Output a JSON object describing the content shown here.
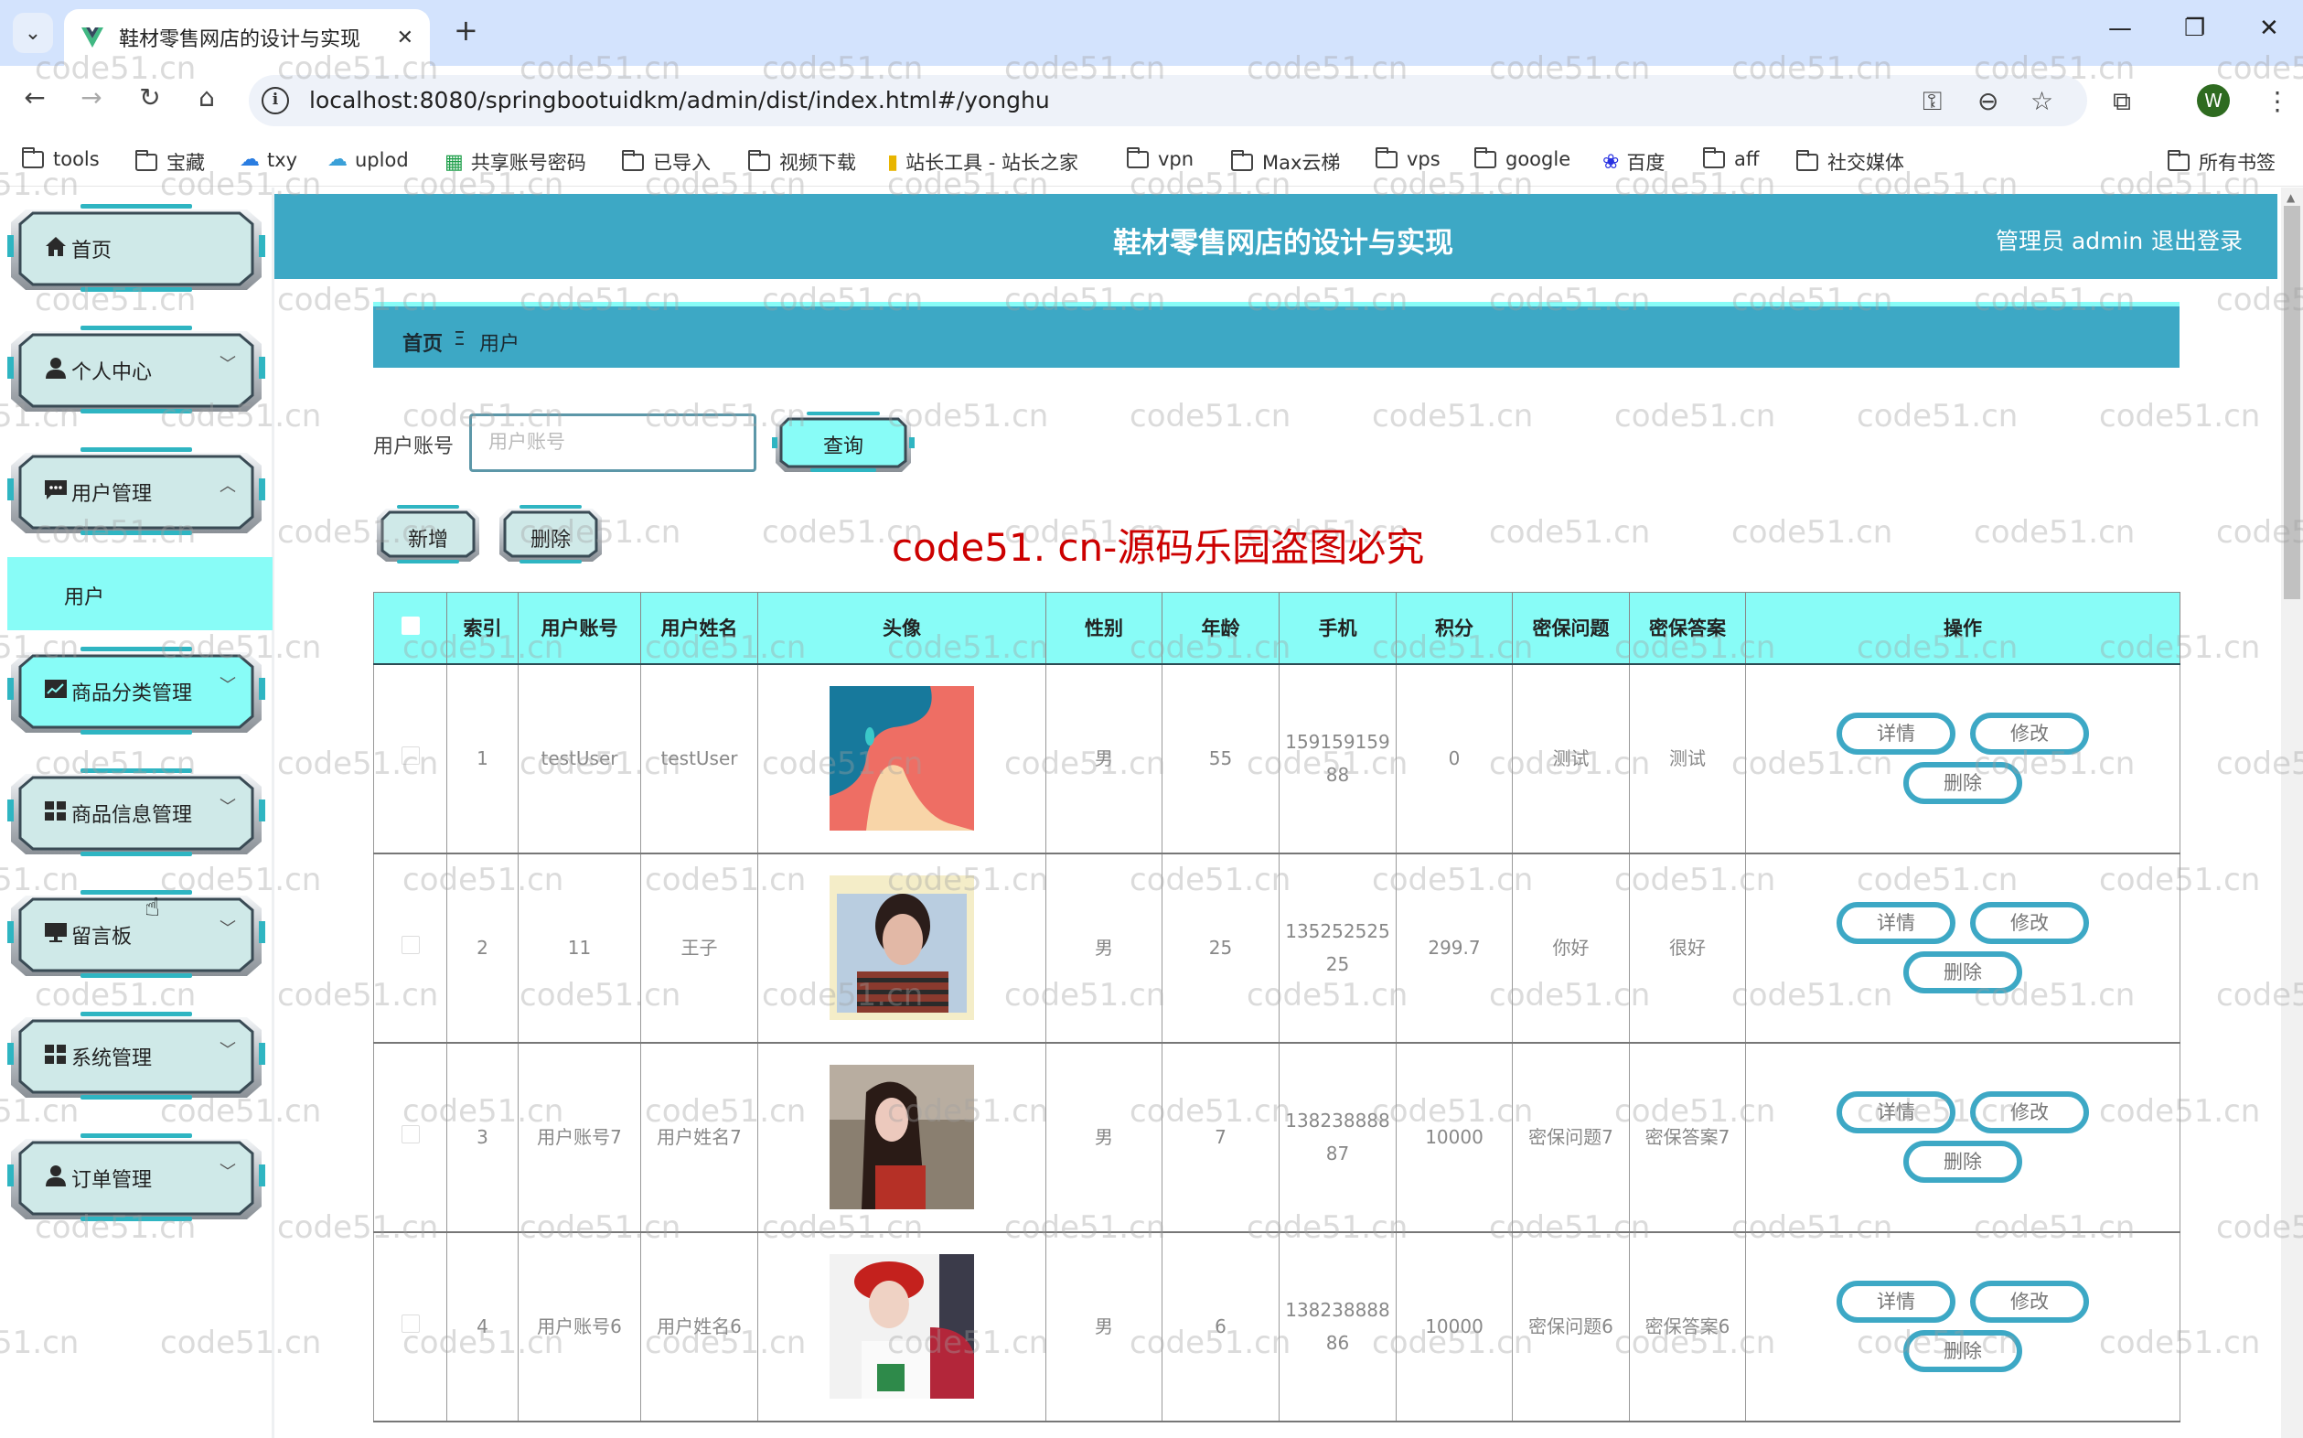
{
  "browser": {
    "tab_title": "鞋材零售网店的设计与实现",
    "url": "localhost:8080/springbootuidkm/admin/dist/index.html#/yonghu",
    "profile_initial": "W",
    "bookmarks": [
      {
        "label": "tools",
        "icon": "folder-icon"
      },
      {
        "label": "宝藏",
        "icon": "folder-icon"
      },
      {
        "label": "txy",
        "icon": "cloud-icon"
      },
      {
        "label": "uplod",
        "icon": "upload-cloud-icon"
      },
      {
        "label": "共享账号密码",
        "icon": "sheets-icon"
      },
      {
        "label": "已导入",
        "icon": "folder-icon"
      },
      {
        "label": "视频下载",
        "icon": "folder-icon"
      },
      {
        "label": "站长工具 - 站长之家",
        "icon": "site-tool-icon"
      },
      {
        "label": "vpn",
        "icon": "folder-icon"
      },
      {
        "label": "Max云梯",
        "icon": "folder-icon"
      },
      {
        "label": "vps",
        "icon": "folder-icon"
      },
      {
        "label": "google",
        "icon": "folder-icon"
      },
      {
        "label": "百度",
        "icon": "baidu-icon"
      },
      {
        "label": "aff",
        "icon": "folder-icon"
      },
      {
        "label": "社交媒体",
        "icon": "folder-icon"
      }
    ],
    "all_bookmarks": "所有书签"
  },
  "header": {
    "title": "鞋材零售网店的设计与实现",
    "user": "管理员 admin",
    "logout": "退出登录"
  },
  "sidebar": {
    "items": [
      {
        "label": "首页",
        "icon": "home-icon",
        "expandable": false
      },
      {
        "label": "个人中心",
        "icon": "user-icon",
        "expandable": true
      },
      {
        "label": "用户管理",
        "icon": "chat-icon",
        "expandable": true,
        "expanded": true
      },
      {
        "label": "商品分类管理",
        "icon": "chart-icon",
        "expandable": true,
        "hovered": true
      },
      {
        "label": "商品信息管理",
        "icon": "grid-icon",
        "expandable": true
      },
      {
        "label": "留言板",
        "icon": "monitor-icon",
        "expandable": true
      },
      {
        "label": "系统管理",
        "icon": "grid-icon",
        "expandable": true
      },
      {
        "label": "订单管理",
        "icon": "user-icon",
        "expandable": true
      }
    ],
    "sub_item": "用户"
  },
  "breadcrumb": {
    "home": "首页",
    "separator": "Ξ",
    "current": "用户"
  },
  "search": {
    "label": "用户账号",
    "placeholder": "用户账号",
    "value": "",
    "query_button": "查询"
  },
  "actions": {
    "add": "新增",
    "delete": "删除"
  },
  "table": {
    "columns": [
      "索引",
      "用户账号",
      "用户姓名",
      "头像",
      "性别",
      "年龄",
      "手机",
      "积分",
      "密保问题",
      "密保答案",
      "操作"
    ],
    "row_actions": {
      "detail": "详情",
      "edit": "修改",
      "delete": "删除"
    },
    "rows": [
      {
        "index": "1",
        "account": "testUser",
        "name": "testUser",
        "avatar": "abstract-avatar",
        "gender": "男",
        "age": "55",
        "phone": "15915915988",
        "points": "0",
        "question": "测试",
        "answer": "测试"
      },
      {
        "index": "2",
        "account": "11",
        "name": "王子",
        "avatar": "young-man-striped-shirt",
        "gender": "男",
        "age": "25",
        "phone": "13525252525",
        "points": "299.7",
        "question": "你好",
        "answer": "很好"
      },
      {
        "index": "3",
        "account": "用户账号7",
        "name": "用户姓名7",
        "avatar": "long-hair-woman",
        "gender": "男",
        "age": "7",
        "phone": "13823888887",
        "points": "10000",
        "question": "密保问题7",
        "answer": "密保答案7"
      },
      {
        "index": "4",
        "account": "用户账号6",
        "name": "用户姓名6",
        "avatar": "man-red-cap",
        "gender": "男",
        "age": "6",
        "phone": "13823888886",
        "points": "10000",
        "question": "密保问题6",
        "answer": "密保答案6"
      }
    ]
  },
  "watermark": {
    "text": "code51.cn",
    "overlay": "code51. cn-源码乐园盗图必究"
  },
  "colors": {
    "primary": "#3da8c5",
    "accent_cyan": "#88fcf7",
    "menu_bg": "#cfe9e8"
  }
}
